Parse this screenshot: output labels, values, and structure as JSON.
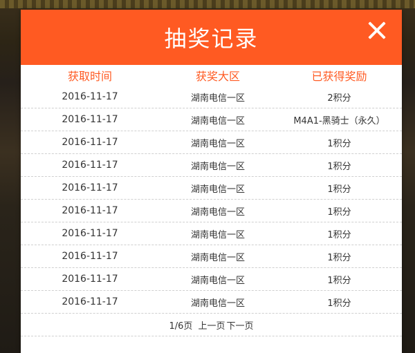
{
  "modal": {
    "title": "抽奖记录",
    "close_icon": "close-icon"
  },
  "table": {
    "headers": [
      "获取时间",
      "获奖大区",
      "已获得奖励"
    ],
    "rows": [
      [
        "2016-11-17",
        "湖南电信一区",
        "2积分"
      ],
      [
        "2016-11-17",
        "湖南电信一区",
        "M4A1-黑骑士（永久）"
      ],
      [
        "2016-11-17",
        "湖南电信一区",
        "1积分"
      ],
      [
        "2016-11-17",
        "湖南电信一区",
        "1积分"
      ],
      [
        "2016-11-17",
        "湖南电信一区",
        "1积分"
      ],
      [
        "2016-11-17",
        "湖南电信一区",
        "1积分"
      ],
      [
        "2016-11-17",
        "湖南电信一区",
        "1积分"
      ],
      [
        "2016-11-17",
        "湖南电信一区",
        "1积分"
      ],
      [
        "2016-11-17",
        "湖南电信一区",
        "1积分"
      ],
      [
        "2016-11-17",
        "湖南电信一区",
        "1积分"
      ]
    ]
  },
  "pager": {
    "status": "1/6页",
    "prev": "上一页",
    "next": "下一页"
  },
  "colors": {
    "accent": "#ff5a22",
    "text": "#333333"
  }
}
